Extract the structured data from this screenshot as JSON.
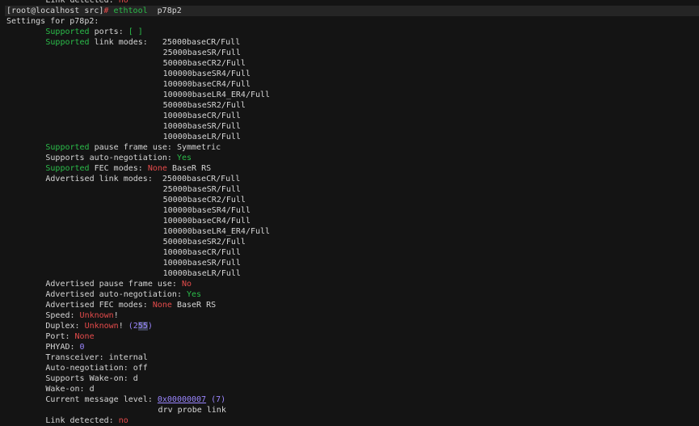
{
  "terminal": {
    "lines": [
      {
        "indent": 8,
        "segs": [
          {
            "t": "Link detected: "
          },
          {
            "t": "no",
            "c": "red"
          }
        ]
      },
      {
        "indent": 0,
        "current": true,
        "segs": [
          {
            "t": "[root@localhost src]"
          },
          {
            "t": "# ",
            "c": "red"
          },
          {
            "t": "ethtool",
            "c": "green"
          },
          {
            "t": "  p78p2"
          }
        ]
      },
      {
        "indent": 0,
        "segs": [
          {
            "t": "Settings for p78p2:"
          }
        ]
      },
      {
        "indent": 8,
        "segs": [
          {
            "t": "Supported",
            "c": "green"
          },
          {
            "t": " ports: "
          },
          {
            "t": "[ ]",
            "c": "green"
          }
        ]
      },
      {
        "indent": 8,
        "segs": [
          {
            "t": "Supported",
            "c": "green"
          },
          {
            "t": " link modes:   25000baseCR/Full"
          }
        ]
      },
      {
        "indent": 32,
        "segs": [
          {
            "t": "25000baseSR/Full"
          }
        ]
      },
      {
        "indent": 32,
        "segs": [
          {
            "t": "50000baseCR2/Full"
          }
        ]
      },
      {
        "indent": 32,
        "segs": [
          {
            "t": "100000baseSR4/Full"
          }
        ]
      },
      {
        "indent": 32,
        "segs": [
          {
            "t": "100000baseCR4/Full"
          }
        ]
      },
      {
        "indent": 32,
        "segs": [
          {
            "t": "100000baseLR4_ER4/Full"
          }
        ]
      },
      {
        "indent": 32,
        "segs": [
          {
            "t": "50000baseSR2/Full"
          }
        ]
      },
      {
        "indent": 32,
        "segs": [
          {
            "t": "10000baseCR/Full"
          }
        ]
      },
      {
        "indent": 32,
        "segs": [
          {
            "t": "10000baseSR/Full"
          }
        ]
      },
      {
        "indent": 32,
        "segs": [
          {
            "t": "10000baseLR/Full"
          }
        ]
      },
      {
        "indent": 8,
        "segs": [
          {
            "t": "Supported",
            "c": "green"
          },
          {
            "t": " pause frame use: Symmetric"
          }
        ]
      },
      {
        "indent": 8,
        "segs": [
          {
            "t": "Supports auto-negotiation: "
          },
          {
            "t": "Yes",
            "c": "green"
          }
        ]
      },
      {
        "indent": 8,
        "segs": [
          {
            "t": "Supported",
            "c": "green"
          },
          {
            "t": " FEC modes: "
          },
          {
            "t": "None",
            "c": "red"
          },
          {
            "t": " BaseR RS"
          }
        ]
      },
      {
        "indent": 8,
        "segs": [
          {
            "t": "Advertised link modes:  25000baseCR/Full"
          }
        ]
      },
      {
        "indent": 32,
        "segs": [
          {
            "t": "25000baseSR/Full"
          }
        ]
      },
      {
        "indent": 32,
        "segs": [
          {
            "t": "50000baseCR2/Full"
          }
        ]
      },
      {
        "indent": 32,
        "segs": [
          {
            "t": "100000baseSR4/Full"
          }
        ]
      },
      {
        "indent": 32,
        "segs": [
          {
            "t": "100000baseCR4/Full"
          }
        ]
      },
      {
        "indent": 32,
        "segs": [
          {
            "t": "100000baseLR4_ER4/Full"
          }
        ]
      },
      {
        "indent": 32,
        "segs": [
          {
            "t": "50000baseSR2/Full"
          }
        ]
      },
      {
        "indent": 32,
        "segs": [
          {
            "t": "10000baseCR/Full"
          }
        ]
      },
      {
        "indent": 32,
        "segs": [
          {
            "t": "10000baseSR/Full"
          }
        ]
      },
      {
        "indent": 32,
        "segs": [
          {
            "t": "10000baseLR/Full"
          }
        ]
      },
      {
        "indent": 8,
        "segs": [
          {
            "t": "Advertised pause frame use: "
          },
          {
            "t": "No",
            "c": "red"
          }
        ]
      },
      {
        "indent": 8,
        "segs": [
          {
            "t": "Advertised auto-negotiation: "
          },
          {
            "t": "Yes",
            "c": "green"
          }
        ]
      },
      {
        "indent": 8,
        "segs": [
          {
            "t": "Advertised FEC modes: "
          },
          {
            "t": "None",
            "c": "red"
          },
          {
            "t": " BaseR RS"
          }
        ]
      },
      {
        "indent": 8,
        "segs": [
          {
            "t": "Speed: "
          },
          {
            "t": "Unknown",
            "c": "red"
          },
          {
            "t": "!"
          }
        ]
      },
      {
        "indent": 8,
        "segs": [
          {
            "t": "Duplex: "
          },
          {
            "t": "Unknown",
            "c": "red"
          },
          {
            "t": "! "
          },
          {
            "t": "(2",
            "c": "purple"
          },
          {
            "t": "55",
            "c": "purple",
            "hl": true
          },
          {
            "t": ")",
            "c": "purple"
          }
        ]
      },
      {
        "indent": 8,
        "segs": [
          {
            "t": "Port: "
          },
          {
            "t": "None",
            "c": "red"
          }
        ]
      },
      {
        "indent": 8,
        "segs": [
          {
            "t": "PHYAD: "
          },
          {
            "t": "0",
            "c": "purple"
          }
        ]
      },
      {
        "indent": 8,
        "segs": [
          {
            "t": "Transceiver: internal"
          }
        ]
      },
      {
        "indent": 8,
        "segs": [
          {
            "t": "Auto-negotiation: off"
          }
        ]
      },
      {
        "indent": 8,
        "segs": [
          {
            "t": "Supports Wake-on: d"
          }
        ]
      },
      {
        "indent": 8,
        "segs": [
          {
            "t": "Wake-on: d"
          }
        ]
      },
      {
        "indent": 8,
        "segs": [
          {
            "t": "Current message level: "
          },
          {
            "t": "0x00000007",
            "c": "purple",
            "u": true
          },
          {
            "t": " (7)",
            "c": "purple"
          }
        ]
      },
      {
        "indent": 31,
        "segs": [
          {
            "t": "drv probe link"
          }
        ]
      },
      {
        "indent": 8,
        "segs": [
          {
            "t": "Link detected: "
          },
          {
            "t": "no",
            "c": "red"
          }
        ]
      }
    ]
  }
}
